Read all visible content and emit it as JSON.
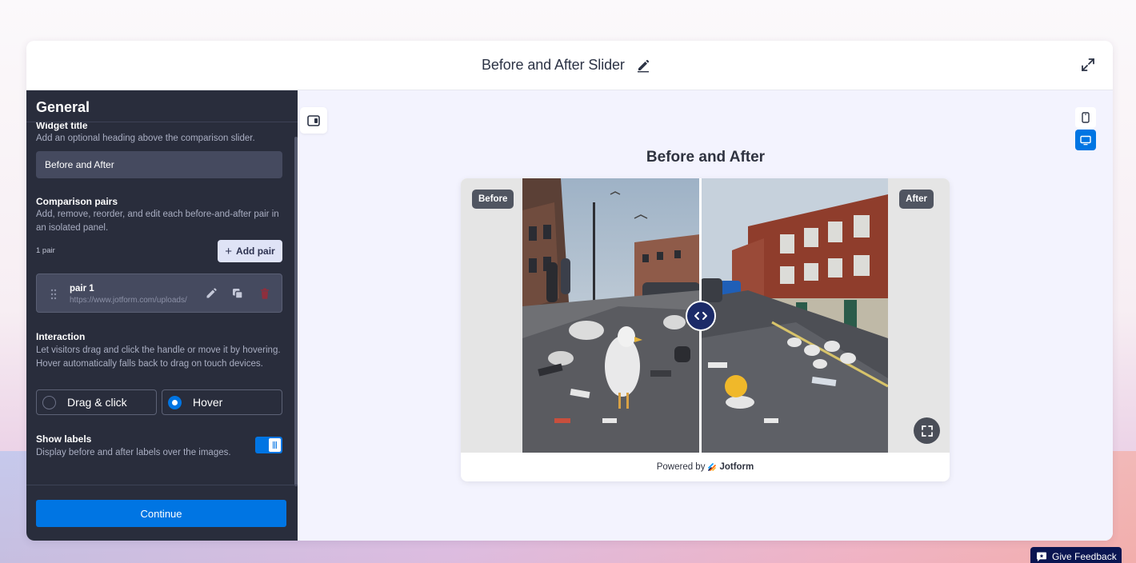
{
  "app": {
    "title": "Before and After Slider"
  },
  "sidebar": {
    "header": "General",
    "widget_title": {
      "label": "Widget title",
      "description": "Add an optional heading above the comparison slider.",
      "value": "Before and After"
    },
    "comparison_pairs": {
      "label": "Comparison pairs",
      "description": "Add, remove, reorder, and edit each before-and-after pair in an isolated panel.",
      "count_text": "1 pair",
      "add_label": "Add pair",
      "items": [
        {
          "name": "pair 1",
          "url": "https://www.jotform.com/uploads/"
        }
      ]
    },
    "interaction": {
      "label": "Interaction",
      "description": "Let visitors drag and click the handle or move it by hovering. Hover automatically falls back to drag on touch devices.",
      "options": [
        "Drag & click",
        "Hover"
      ],
      "selected": "Hover"
    },
    "show_labels": {
      "label": "Show labels",
      "description": "Display before and after labels over the images.",
      "enabled": true
    },
    "continue_label": "Continue"
  },
  "preview": {
    "heading": "Before and After",
    "before_label": "Before",
    "after_label": "After",
    "powered_by": "Powered by",
    "brand": "Jotform",
    "slider_position": 0.5
  },
  "feedback": {
    "label": "Give Feedback"
  },
  "colors": {
    "accent": "#0075e3",
    "sidebar_bg": "#292d3c",
    "preview_bg": "#f3f3fe",
    "handle": "#1c2b68",
    "feedback_bg": "#0a1551"
  }
}
